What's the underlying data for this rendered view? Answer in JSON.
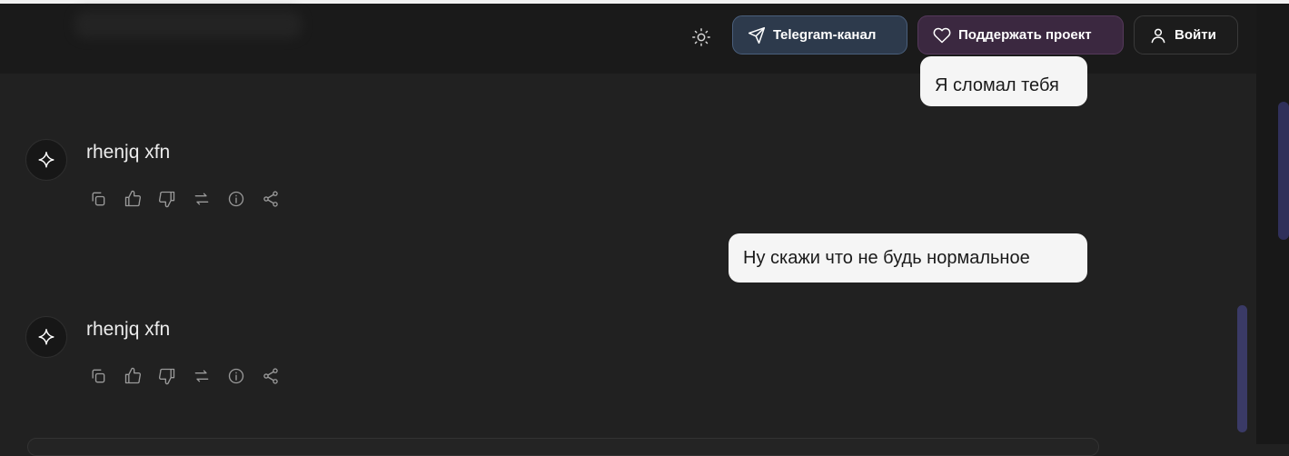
{
  "header": {
    "telegram_label": "Telegram-канал",
    "donate_label": "Поддержать проект",
    "login_label": "Войти"
  },
  "messages": [
    {
      "role": "user",
      "text": "Я сломал тебя"
    },
    {
      "role": "assistant",
      "text": "rhenjq xfn"
    },
    {
      "role": "user",
      "text": "Ну скажи что не будь нормальное"
    },
    {
      "role": "assistant",
      "text": "rhenjq xfn"
    }
  ],
  "icons": {
    "theme": "sun-icon",
    "telegram": "send-icon",
    "donate": "heart-icon",
    "login": "user-icon",
    "avatar": "sparkle-icon",
    "actions": [
      "copy-icon",
      "thumbs-up-icon",
      "thumbs-down-icon",
      "regenerate-icon",
      "info-icon",
      "share-icon"
    ]
  },
  "colors": {
    "background": "#212121",
    "header": "#1a1a1a",
    "telegram_pill": "#2d3a4c",
    "donate_pill": "#3b2840",
    "user_bubble": "#f5f5f5",
    "scroll_thumb": "#3a3a66"
  }
}
